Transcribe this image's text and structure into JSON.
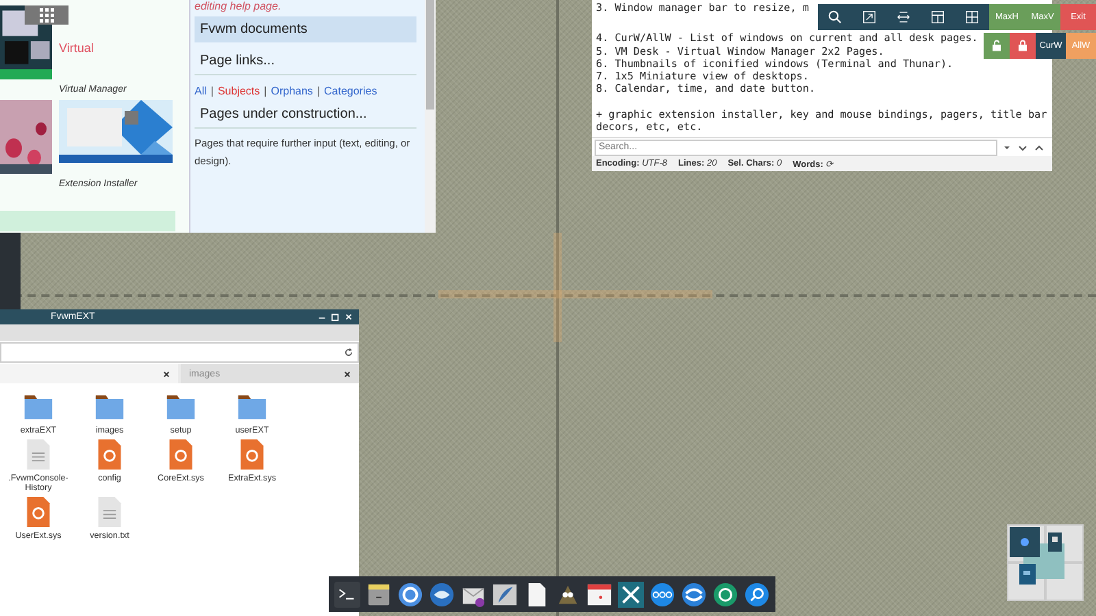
{
  "browser": {
    "help_link": "editing help page.",
    "thumb_link": "Virtual",
    "captions": [
      "Virtual Manager",
      "Extension Installer"
    ],
    "sidebar": {
      "sections": [
        {
          "title": "Fvwm documents",
          "selected": true
        },
        {
          "title": "Page links...",
          "selected": false
        }
      ],
      "separator": "|",
      "links": [
        {
          "label": "All",
          "color": "#3366cc"
        },
        {
          "label": "Subjects",
          "color": "#dd3333"
        },
        {
          "label": "Orphans",
          "color": "#3366cc"
        },
        {
          "label": "Categories",
          "color": "#3366cc"
        }
      ],
      "construction_title": "Pages under construction...",
      "construction_text": "Pages that require further input (text, editing, or design)."
    }
  },
  "editor": {
    "lines": [
      "3. Window manager bar to resize, m",
      "4. CurW/AllW - List of windows on current and all desk pages.",
      "5. VM Desk - Virtual Window Manager 2x2 Pages.",
      "6. Thumbnails of iconified windows (Terminal and Thunar).",
      "7. 1x5 Miniature view of desktops.",
      "8. Calendar, time, and date button."
    ],
    "note": "+ graphic extension installer, key and mouse bindings, pagers, title bar decors, etc, etc.",
    "search": {
      "placeholder": "Search..."
    },
    "status": [
      {
        "label": "Encoding:",
        "value": "UTF-8"
      },
      {
        "label": "Lines:",
        "value": "20"
      },
      {
        "label": "Sel. Chars:",
        "value": "0"
      },
      {
        "label": "Words:",
        "value": "⟳"
      }
    ]
  },
  "wm_bar": {
    "buttons": [
      {
        "label": "MaxH",
        "color": "#6a9e5a"
      },
      {
        "label": "MaxV",
        "color": "#6a9e5a"
      },
      {
        "label": "Exit",
        "color": "#e05555"
      }
    ],
    "row2": [
      {
        "kind": "unlock",
        "color": "#6a9e5a"
      },
      {
        "kind": "lock",
        "color": "#e05555"
      },
      {
        "kind": "text",
        "label": "CurW",
        "color": "#26495a"
      },
      {
        "kind": "text",
        "label": "AllW",
        "color": "#f0a060"
      }
    ]
  },
  "file_manager": {
    "title": "FvwmEXT",
    "tabs": [
      {
        "selected": true
      },
      {
        "label": "images",
        "selected": false
      }
    ],
    "files": [
      {
        "name": "extraEXT",
        "kind": "folder"
      },
      {
        "name": "images",
        "kind": "folder"
      },
      {
        "name": "setup",
        "kind": "folder"
      },
      {
        "name": "userEXT",
        "kind": "folder"
      },
      {
        "name": ".FvwmConsole-History",
        "kind": "text"
      },
      {
        "name": "config",
        "kind": "sys"
      },
      {
        "name": "CoreExt.sys",
        "kind": "sys"
      },
      {
        "name": "ExtraExt.sys",
        "kind": "sys"
      },
      {
        "name": "UserExt.sys",
        "kind": "sys"
      },
      {
        "name": "version.txt",
        "kind": "text"
      }
    ]
  }
}
